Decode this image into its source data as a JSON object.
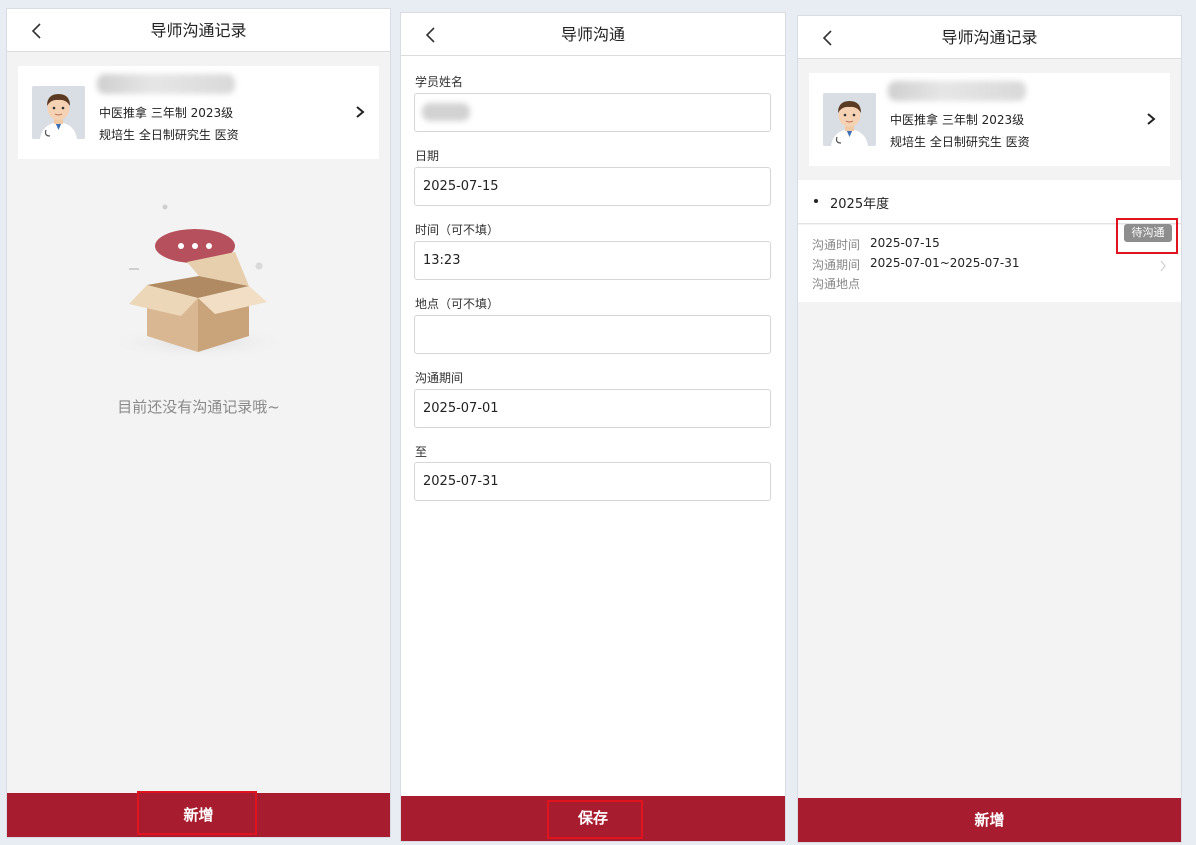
{
  "list_empty": {
    "header": {
      "title": "导师沟通记录"
    },
    "profile": {
      "line1": "中医推拿 三年制 2023级",
      "line2": "规培生 全日制研究生 医资"
    },
    "empty_text": "目前还没有沟通记录哦~",
    "add_button": "新增"
  },
  "form": {
    "header": {
      "title": "导师沟通"
    },
    "fields": [
      {
        "label": "学员姓名",
        "value": ""
      },
      {
        "label": "日期",
        "value": "2025-07-15"
      },
      {
        "label": "时间（可不填）",
        "value": "13:23"
      },
      {
        "label": "地点（可不填）",
        "value": ""
      },
      {
        "label": "沟通期间",
        "value": "2025-07-01"
      },
      {
        "label": "至",
        "value": "2025-07-31"
      }
    ],
    "save_button": "保存"
  },
  "list_filled": {
    "header": {
      "title": "导师沟通记录"
    },
    "profile": {
      "line1": "中医推拿 三年制 2023级",
      "line2": "规培生 全日制研究生 医资"
    },
    "year_label": "2025年度",
    "record": {
      "time_key": "沟通时间",
      "time_value": "2025-07-15",
      "period_key": "沟通期间",
      "period_value": "2025-07-01~2025-07-31",
      "place_key": "沟通地点",
      "place_value": "",
      "status": "待沟通"
    },
    "add_button": "新增"
  },
  "colors": {
    "accent": "#a71c2e",
    "highlight": "#e0141e"
  }
}
